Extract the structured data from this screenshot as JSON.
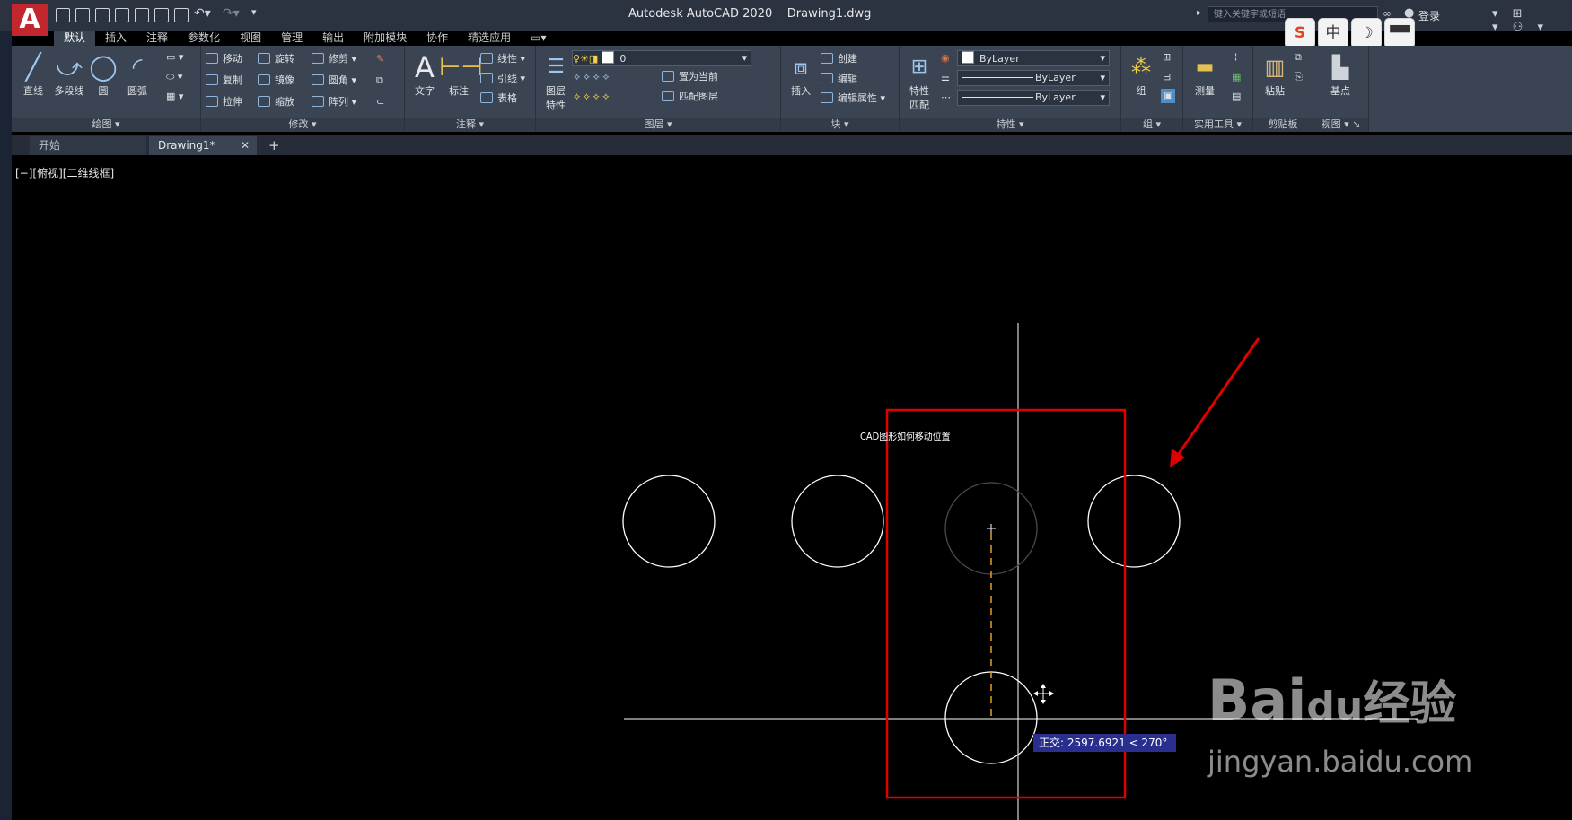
{
  "titlebar": {
    "app_letter": "A",
    "app_name": "Autodesk AutoCAD 2020",
    "document": "Drawing1.dwg",
    "search_placeholder": "键入关键字或短语",
    "login": "登录"
  },
  "ime": {
    "sogou": "S",
    "lang": "中",
    "moon": "☽",
    "skin": "👕"
  },
  "ribbon_tabs": [
    "默认",
    "插入",
    "注释",
    "参数化",
    "视图",
    "管理",
    "输出",
    "附加模块",
    "协作",
    "精选应用"
  ],
  "ribbon": {
    "draw": {
      "title": "绘图",
      "line": "直线",
      "polyline": "多段线",
      "circle": "圆",
      "arc": "圆弧"
    },
    "modify": {
      "title": "修改",
      "move": "移动",
      "rotate": "旋转",
      "trim": "修剪",
      "copy": "复制",
      "mirror": "镜像",
      "fillet": "圆角",
      "stretch": "拉伸",
      "scale": "缩放",
      "array": "阵列"
    },
    "annotation": {
      "title": "注释",
      "text": "文字",
      "dimension": "标注",
      "linear": "线性",
      "leader": "引线",
      "table": "表格"
    },
    "layers": {
      "title": "图层",
      "layer_props_1": "图层",
      "layer_props_2": "特性",
      "current_layer": "0",
      "set_current": "置为当前",
      "match_layer": "匹配图层"
    },
    "block": {
      "title": "块",
      "insert": "插入",
      "create": "创建",
      "edit": "编辑",
      "edit_attr": "编辑属性"
    },
    "properties": {
      "title": "特性",
      "match_1": "特性",
      "match_2": "匹配",
      "color": "ByLayer",
      "linetype": "ByLayer",
      "lineweight": "ByLayer"
    },
    "groups": {
      "title": "组",
      "group": "组"
    },
    "utilities": {
      "title": "实用工具",
      "measure": "测量"
    },
    "clipboard": {
      "title": "剪贴板",
      "paste": "粘贴"
    },
    "view": {
      "title": "视图",
      "base": "基点"
    }
  },
  "doc_tabs": {
    "start": "开始",
    "drawing": "Drawing1*",
    "add": "+"
  },
  "viewport": {
    "label": "[−][俯视][二维线框]",
    "title_text": "CAD图形如何移动位置",
    "tooltip": "正交: 2597.6921 < 270°"
  },
  "watermark": {
    "brand": "Bai",
    "paw": "du",
    "product": "经验",
    "url": "jingyan.baidu.com"
  },
  "colors": {
    "highlight": "#e00000",
    "tracking": "#e3a020",
    "ui_dark": "#2b3240",
    "ribbon": "#3b4453"
  }
}
